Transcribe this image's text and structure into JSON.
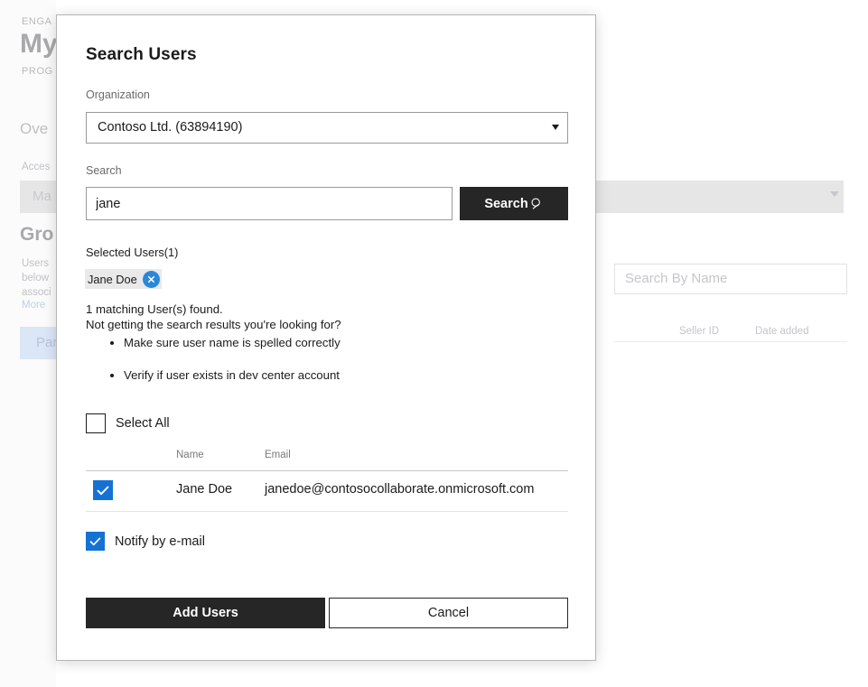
{
  "background": {
    "eyebrow_top": "ENGA",
    "heading": "My",
    "eyebrow_second": "PROG",
    "nav_item": "Ove",
    "access_label": "Acces",
    "manage_dropdown": "Ma",
    "group_heading": "Gro",
    "description_line1": "Users",
    "description_line2": "below",
    "description_line3": "associ",
    "more_link": "More",
    "tab_label": "Par",
    "search_by_name_placeholder": "Search By Name",
    "search_icon": "search-icon",
    "columns": [
      "Seller ID",
      "Date added"
    ]
  },
  "modal": {
    "title": "Search Users",
    "organization": {
      "label": "Organization",
      "selected": "Contoso Ltd. (63894190)",
      "caret_icon": "chevron-down-icon"
    },
    "search": {
      "label": "Search",
      "value": "jane",
      "button_label": "Search",
      "button_icon": "search-icon"
    },
    "selected_users": {
      "label": "Selected Users(1)",
      "chips": [
        {
          "name": "Jane Doe",
          "remove_icon": "close-icon"
        }
      ]
    },
    "results_message": {
      "count_text": "1 matching User(s) found.",
      "question": "Not getting the search results you're looking for?",
      "hints": [
        "Make sure user name is spelled correctly",
        "Verify if user exists in dev center account"
      ]
    },
    "select_all": {
      "label": "Select All",
      "checked": false
    },
    "results_table": {
      "columns": [
        "Name",
        "Email"
      ],
      "rows": [
        {
          "checked": true,
          "name": "Jane Doe",
          "email": "janedoe@contosocollaborate.onmicrosoft.com"
        }
      ]
    },
    "notify": {
      "label": "Notify by e-mail",
      "checked": true
    },
    "footer": {
      "primary_label": "Add Users",
      "secondary_label": "Cancel"
    }
  },
  "colors": {
    "accent_blue": "#1572d3",
    "chip_badge_blue": "#2b88d8",
    "dark_button": "#262626",
    "modal_border": "#b5b5b5"
  }
}
